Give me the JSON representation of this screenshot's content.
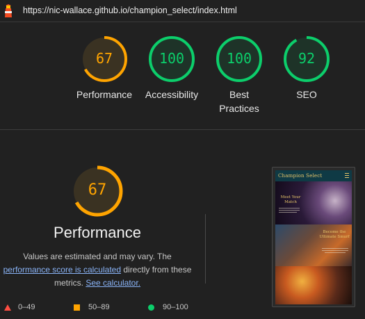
{
  "topbar": {
    "url": "https://nic-wallace.github.io/champion_select/index.html",
    "logo_icon": "lighthouse-icon"
  },
  "colors": {
    "background": "#212121",
    "average": "#ffa400",
    "pass": "#0cce6b",
    "fail": "#ff4e42",
    "link": "#8ab4f8"
  },
  "scores": [
    {
      "label": "Performance",
      "value": "67",
      "status": "average"
    },
    {
      "label": "Accessibility",
      "value": "100",
      "status": "pass"
    },
    {
      "label": "Best Practices",
      "value": "100",
      "status": "pass"
    },
    {
      "label": "SEO",
      "value": "92",
      "status": "pass"
    }
  ],
  "main": {
    "score": "67",
    "title": "Performance",
    "desc_1": "Values are estimated and may vary. The",
    "desc_link_1": "performance score is calculated",
    "desc_2": " directly from these",
    "desc_3": "metrics. ",
    "desc_link_2": "See calculator."
  },
  "legend": [
    {
      "range": "0–49",
      "icon": "triangle-icon"
    },
    {
      "range": "50–89",
      "icon": "square-icon"
    },
    {
      "range": "90–100",
      "icon": "circle-icon"
    }
  ],
  "screenshot": {
    "site_title": "Champion Select",
    "hero1_text": "Meet Your Match",
    "hero2_text": "Become the Ultimate Smurf"
  }
}
